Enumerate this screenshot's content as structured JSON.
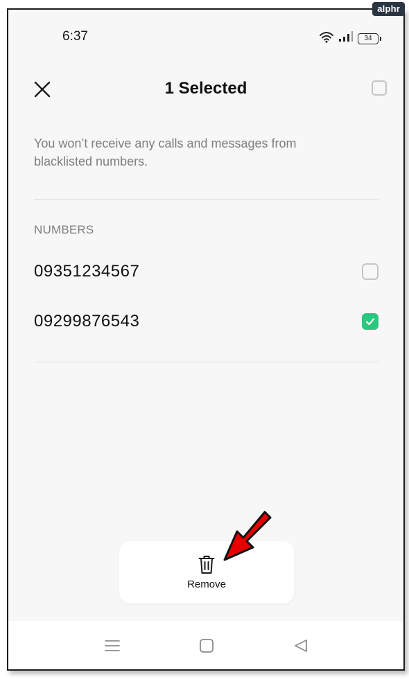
{
  "watermark": "alphr",
  "status_bar": {
    "time": "6:37",
    "battery": "34",
    "icons": [
      "wifi-icon",
      "signal-icon",
      "battery-icon"
    ]
  },
  "header": {
    "title": "1 Selected",
    "close_icon": "close-icon"
  },
  "description": "You won’t receive any calls and messages from blacklisted numbers.",
  "numbers_section": {
    "label": "NUMBERS",
    "items": [
      {
        "number": "09351234567",
        "checked": false
      },
      {
        "number": "09299876543",
        "checked": true
      }
    ]
  },
  "action": {
    "remove_label": "Remove",
    "icon": "trash-icon"
  },
  "nav_bar": {
    "buttons": [
      "menu-icon",
      "home-icon",
      "back-icon"
    ]
  },
  "colors": {
    "accent_check": "#2bc77f",
    "annotation_arrow": "#e60000",
    "background": "#f7f7f7"
  }
}
